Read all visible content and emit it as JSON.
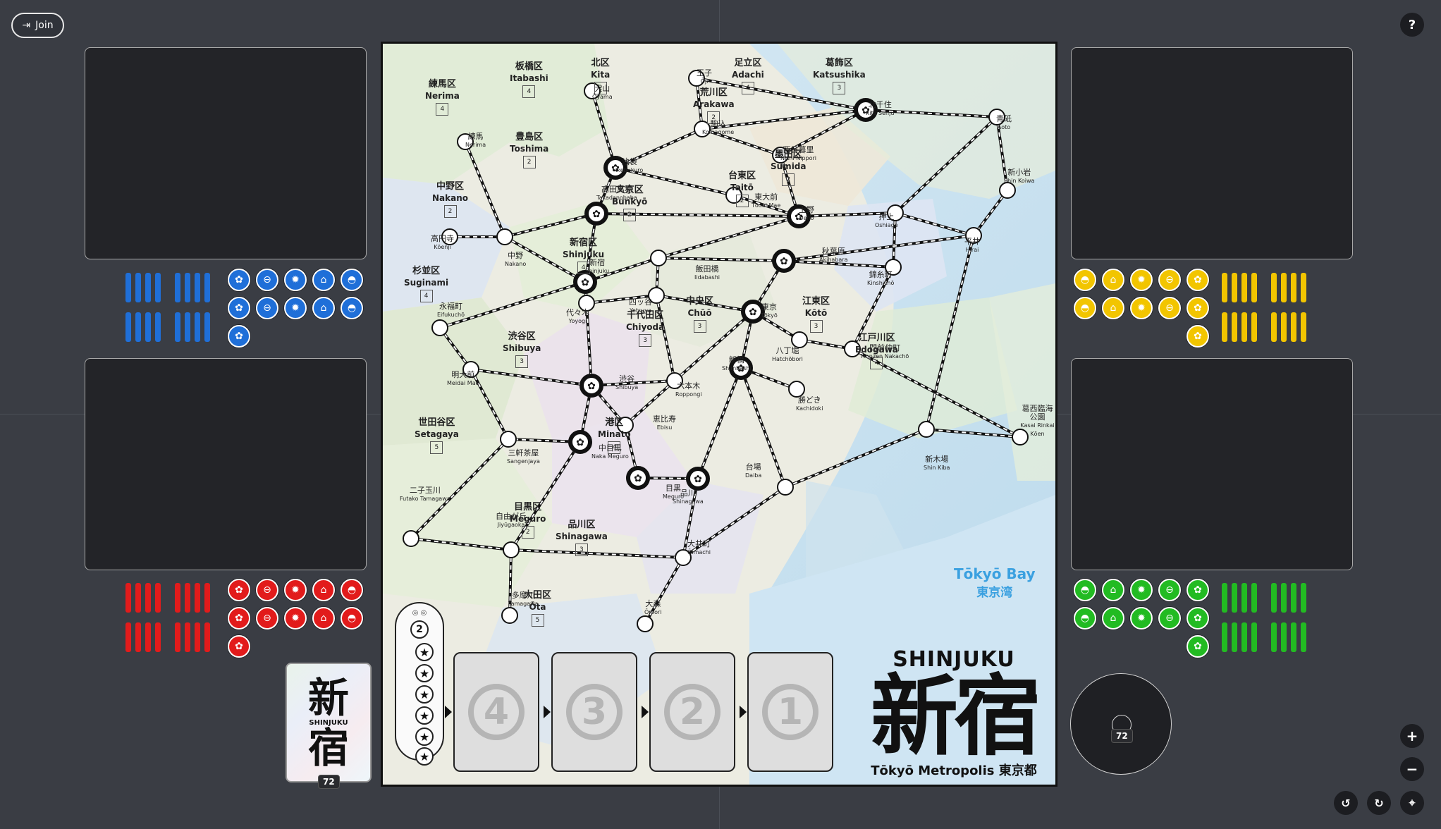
{
  "toolbar": {
    "join_label": "Join",
    "help_label": "?"
  },
  "players": {
    "blue": {
      "color": "#1f6fd8",
      "icons": [
        "sakura",
        "car",
        "gear",
        "house",
        "bowl",
        "sakura",
        "car",
        "gear",
        "house",
        "bowl",
        "sakura"
      ]
    },
    "yellow": {
      "color": "#f2c500",
      "icons": [
        "bowl",
        "house",
        "gear",
        "car",
        "sakura",
        "bowl",
        "house",
        "gear",
        "car",
        "sakura",
        "sakura"
      ]
    },
    "red": {
      "color": "#e21b1b",
      "icons": [
        "sakura",
        "car",
        "gear",
        "house",
        "bowl",
        "sakura",
        "car",
        "gear",
        "house",
        "bowl",
        "sakura"
      ]
    },
    "green": {
      "color": "#22bb22",
      "icons": [
        "bowl",
        "house",
        "gear",
        "car",
        "sakura",
        "bowl",
        "house",
        "gear",
        "car",
        "sakura",
        "sakura"
      ]
    }
  },
  "board": {
    "wards": [
      {
        "jp": "練馬区",
        "en": "Nerima",
        "num": "4"
      },
      {
        "jp": "板橋区",
        "en": "Itabashi",
        "num": "4"
      },
      {
        "jp": "北区",
        "en": "Kita",
        "num": "2"
      },
      {
        "jp": "足立区",
        "en": "Adachi",
        "num": "4"
      },
      {
        "jp": "葛飾区",
        "en": "Katsushika",
        "num": "3"
      },
      {
        "jp": "荒川区",
        "en": "Arakawa",
        "num": "2"
      },
      {
        "jp": "豊島区",
        "en": "Toshima",
        "num": "2"
      },
      {
        "jp": "中野区",
        "en": "Nakano",
        "num": "2"
      },
      {
        "jp": "文京区",
        "en": "Bunkyō",
        "num": "2"
      },
      {
        "jp": "台東区",
        "en": "Taitō",
        "num": "2"
      },
      {
        "jp": "墨田区",
        "en": "Sumida",
        "num": "2"
      },
      {
        "jp": "新宿区",
        "en": "Shinjuku",
        "num": "4"
      },
      {
        "jp": "杉並区",
        "en": "Suginami",
        "num": "4"
      },
      {
        "jp": "千代田区",
        "en": "Chiyoda",
        "num": "3"
      },
      {
        "jp": "中央区",
        "en": "Chūō",
        "num": "3"
      },
      {
        "jp": "江東区",
        "en": "Kōtō",
        "num": "3"
      },
      {
        "jp": "渋谷区",
        "en": "Shibuya",
        "num": "3"
      },
      {
        "jp": "江戸川区",
        "en": "Edogawa",
        "num": "4"
      },
      {
        "jp": "世田谷区",
        "en": "Setagaya",
        "num": "5"
      },
      {
        "jp": "港区",
        "en": "Minato",
        "num": "4"
      },
      {
        "jp": "目黒区",
        "en": "Meguro",
        "num": "2"
      },
      {
        "jp": "品川区",
        "en": "Shinagawa",
        "num": "3"
      },
      {
        "jp": "大田区",
        "en": "Ōta",
        "num": "5"
      }
    ],
    "stations": [
      {
        "jp": "大山",
        "en": "Ōyama"
      },
      {
        "jp": "王子",
        "en": "Ōji"
      },
      {
        "jp": "北千住",
        "en": "Kita Senju"
      },
      {
        "jp": "青砥",
        "en": "Aoto"
      },
      {
        "jp": "練馬",
        "en": "Nerima"
      },
      {
        "jp": "駒込",
        "en": "Komagome"
      },
      {
        "jp": "西日暮里",
        "en": "Nishi Nippori"
      },
      {
        "jp": "池袋",
        "en": "Ikebukuro"
      },
      {
        "jp": "新小岩",
        "en": "Shin Koiwa"
      },
      {
        "jp": "高田馬場",
        "en": "Takadanobaba"
      },
      {
        "jp": "東大前",
        "en": "Tōdai Mae"
      },
      {
        "jp": "上野",
        "en": "Ueno"
      },
      {
        "jp": "押上",
        "en": "Oshiage"
      },
      {
        "jp": "平井",
        "en": "Hirai"
      },
      {
        "jp": "高円寺",
        "en": "Kōenji"
      },
      {
        "jp": "中野",
        "en": "Nakano"
      },
      {
        "jp": "新宿",
        "en": "Shinjuku"
      },
      {
        "jp": "飯田橋",
        "en": "Iidabashi"
      },
      {
        "jp": "秋葉原",
        "en": "Akihabara"
      },
      {
        "jp": "錦糸町",
        "en": "Kinshichō"
      },
      {
        "jp": "永福町",
        "en": "Eifukuchō"
      },
      {
        "jp": "代々木",
        "en": "Yoyogi"
      },
      {
        "jp": "四ッ谷",
        "en": "Yotsuya"
      },
      {
        "jp": "東京",
        "en": "Tōkyō"
      },
      {
        "jp": "八丁堀",
        "en": "Hatchōbori"
      },
      {
        "jp": "門前仲町",
        "en": "Monzen Nakachō"
      },
      {
        "jp": "明大前",
        "en": "Meidai Mae"
      },
      {
        "jp": "渋谷",
        "en": "Shibuya"
      },
      {
        "jp": "六本木",
        "en": "Roppongi"
      },
      {
        "jp": "新橋",
        "en": "Shimbashi"
      },
      {
        "jp": "勝どき",
        "en": "Kachidoki"
      },
      {
        "jp": "葛西臨海公園",
        "en": "Kasai Rinkai Kōen"
      },
      {
        "jp": "三軒茶屋",
        "en": "Sangenjaya"
      },
      {
        "jp": "恵比寿",
        "en": "Ebisu"
      },
      {
        "jp": "中目黒",
        "en": "Naka Meguro"
      },
      {
        "jp": "新木場",
        "en": "Shin Kiba"
      },
      {
        "jp": "品川",
        "en": "Shinagawa"
      },
      {
        "jp": "目黒",
        "en": "Meguro"
      },
      {
        "jp": "台場",
        "en": "Daiba"
      },
      {
        "jp": "二子玉川",
        "en": "Futako Tamagawa"
      },
      {
        "jp": "自由が丘",
        "en": "Jiyūgaoka"
      },
      {
        "jp": "大井町",
        "en": "Ōimachi"
      },
      {
        "jp": "多摩川",
        "en": "Tamagawa"
      },
      {
        "jp": "大森",
        "en": "Ōmori"
      }
    ],
    "bay_en": "Tōkyō Bay",
    "bay_jp": "東京湾",
    "score_track_number": "2",
    "slots": [
      "4",
      "3",
      "2",
      "1"
    ],
    "title_en": "SHINJUKU",
    "title_jp": "新宿",
    "title_sub": "Tōkyō Metropolis 東京都"
  },
  "deck": {
    "kanji_top": "新",
    "label": "SHINJUKU",
    "kanji_bottom": "宿",
    "count": "72"
  },
  "discard": {
    "count": "72"
  },
  "controls": {
    "zoom_in": "+",
    "zoom_out": "−"
  }
}
